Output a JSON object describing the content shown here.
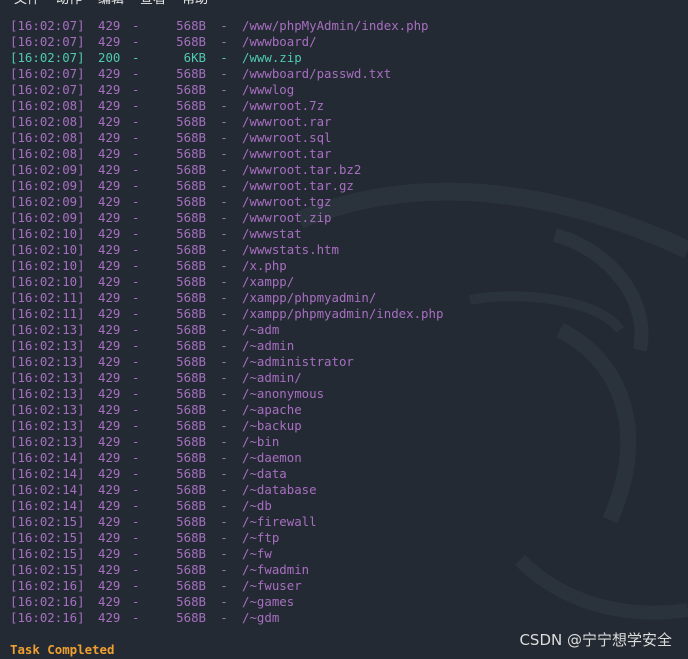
{
  "menu": [
    "文件",
    "动作",
    "编辑",
    "查看",
    "帮助"
  ],
  "colors": {
    "background": "#232a33",
    "default_text": "#a76fc0",
    "success_text": "#4fc9b0",
    "task_text": "#f0a030"
  },
  "log_lines": [
    {
      "time": "[16:02:07]",
      "code": "429",
      "size": "568B",
      "path": "/www/phpMyAdmin/index.php",
      "ok": false
    },
    {
      "time": "[16:02:07]",
      "code": "429",
      "size": "568B",
      "path": "/wwwboard/",
      "ok": false
    },
    {
      "time": "[16:02:07]",
      "code": "200",
      "size": "6KB",
      "path": "/www.zip",
      "ok": true
    },
    {
      "time": "[16:02:07]",
      "code": "429",
      "size": "568B",
      "path": "/wwwboard/passwd.txt",
      "ok": false
    },
    {
      "time": "[16:02:07]",
      "code": "429",
      "size": "568B",
      "path": "/wwwlog",
      "ok": false
    },
    {
      "time": "[16:02:08]",
      "code": "429",
      "size": "568B",
      "path": "/wwwroot.7z",
      "ok": false
    },
    {
      "time": "[16:02:08]",
      "code": "429",
      "size": "568B",
      "path": "/wwwroot.rar",
      "ok": false
    },
    {
      "time": "[16:02:08]",
      "code": "429",
      "size": "568B",
      "path": "/wwwroot.sql",
      "ok": false
    },
    {
      "time": "[16:02:08]",
      "code": "429",
      "size": "568B",
      "path": "/wwwroot.tar",
      "ok": false
    },
    {
      "time": "[16:02:09]",
      "code": "429",
      "size": "568B",
      "path": "/wwwroot.tar.bz2",
      "ok": false
    },
    {
      "time": "[16:02:09]",
      "code": "429",
      "size": "568B",
      "path": "/wwwroot.tar.gz",
      "ok": false
    },
    {
      "time": "[16:02:09]",
      "code": "429",
      "size": "568B",
      "path": "/wwwroot.tgz",
      "ok": false
    },
    {
      "time": "[16:02:09]",
      "code": "429",
      "size": "568B",
      "path": "/wwwroot.zip",
      "ok": false
    },
    {
      "time": "[16:02:10]",
      "code": "429",
      "size": "568B",
      "path": "/wwwstat",
      "ok": false
    },
    {
      "time": "[16:02:10]",
      "code": "429",
      "size": "568B",
      "path": "/wwwstats.htm",
      "ok": false
    },
    {
      "time": "[16:02:10]",
      "code": "429",
      "size": "568B",
      "path": "/x.php",
      "ok": false
    },
    {
      "time": "[16:02:10]",
      "code": "429",
      "size": "568B",
      "path": "/xampp/",
      "ok": false
    },
    {
      "time": "[16:02:11]",
      "code": "429",
      "size": "568B",
      "path": "/xampp/phpmyadmin/",
      "ok": false
    },
    {
      "time": "[16:02:11]",
      "code": "429",
      "size": "568B",
      "path": "/xampp/phpmyadmin/index.php",
      "ok": false
    },
    {
      "time": "[16:02:13]",
      "code": "429",
      "size": "568B",
      "path": "/~adm",
      "ok": false
    },
    {
      "time": "[16:02:13]",
      "code": "429",
      "size": "568B",
      "path": "/~admin",
      "ok": false
    },
    {
      "time": "[16:02:13]",
      "code": "429",
      "size": "568B",
      "path": "/~administrator",
      "ok": false
    },
    {
      "time": "[16:02:13]",
      "code": "429",
      "size": "568B",
      "path": "/~admin/",
      "ok": false
    },
    {
      "time": "[16:02:13]",
      "code": "429",
      "size": "568B",
      "path": "/~anonymous",
      "ok": false
    },
    {
      "time": "[16:02:13]",
      "code": "429",
      "size": "568B",
      "path": "/~apache",
      "ok": false
    },
    {
      "time": "[16:02:13]",
      "code": "429",
      "size": "568B",
      "path": "/~backup",
      "ok": false
    },
    {
      "time": "[16:02:13]",
      "code": "429",
      "size": "568B",
      "path": "/~bin",
      "ok": false
    },
    {
      "time": "[16:02:14]",
      "code": "429",
      "size": "568B",
      "path": "/~daemon",
      "ok": false
    },
    {
      "time": "[16:02:14]",
      "code": "429",
      "size": "568B",
      "path": "/~data",
      "ok": false
    },
    {
      "time": "[16:02:14]",
      "code": "429",
      "size": "568B",
      "path": "/~database",
      "ok": false
    },
    {
      "time": "[16:02:14]",
      "code": "429",
      "size": "568B",
      "path": "/~db",
      "ok": false
    },
    {
      "time": "[16:02:15]",
      "code": "429",
      "size": "568B",
      "path": "/~firewall",
      "ok": false
    },
    {
      "time": "[16:02:15]",
      "code": "429",
      "size": "568B",
      "path": "/~ftp",
      "ok": false
    },
    {
      "time": "[16:02:15]",
      "code": "429",
      "size": "568B",
      "path": "/~fw",
      "ok": false
    },
    {
      "time": "[16:02:15]",
      "code": "429",
      "size": "568B",
      "path": "/~fwadmin",
      "ok": false
    },
    {
      "time": "[16:02:16]",
      "code": "429",
      "size": "568B",
      "path": "/~fwuser",
      "ok": false
    },
    {
      "time": "[16:02:16]",
      "code": "429",
      "size": "568B",
      "path": "/~games",
      "ok": false
    },
    {
      "time": "[16:02:16]",
      "code": "429",
      "size": "568B",
      "path": "/~gdm",
      "ok": false
    }
  ],
  "status": {
    "task": "Task Completed"
  },
  "watermark": "CSDN @宁宁想学安全"
}
